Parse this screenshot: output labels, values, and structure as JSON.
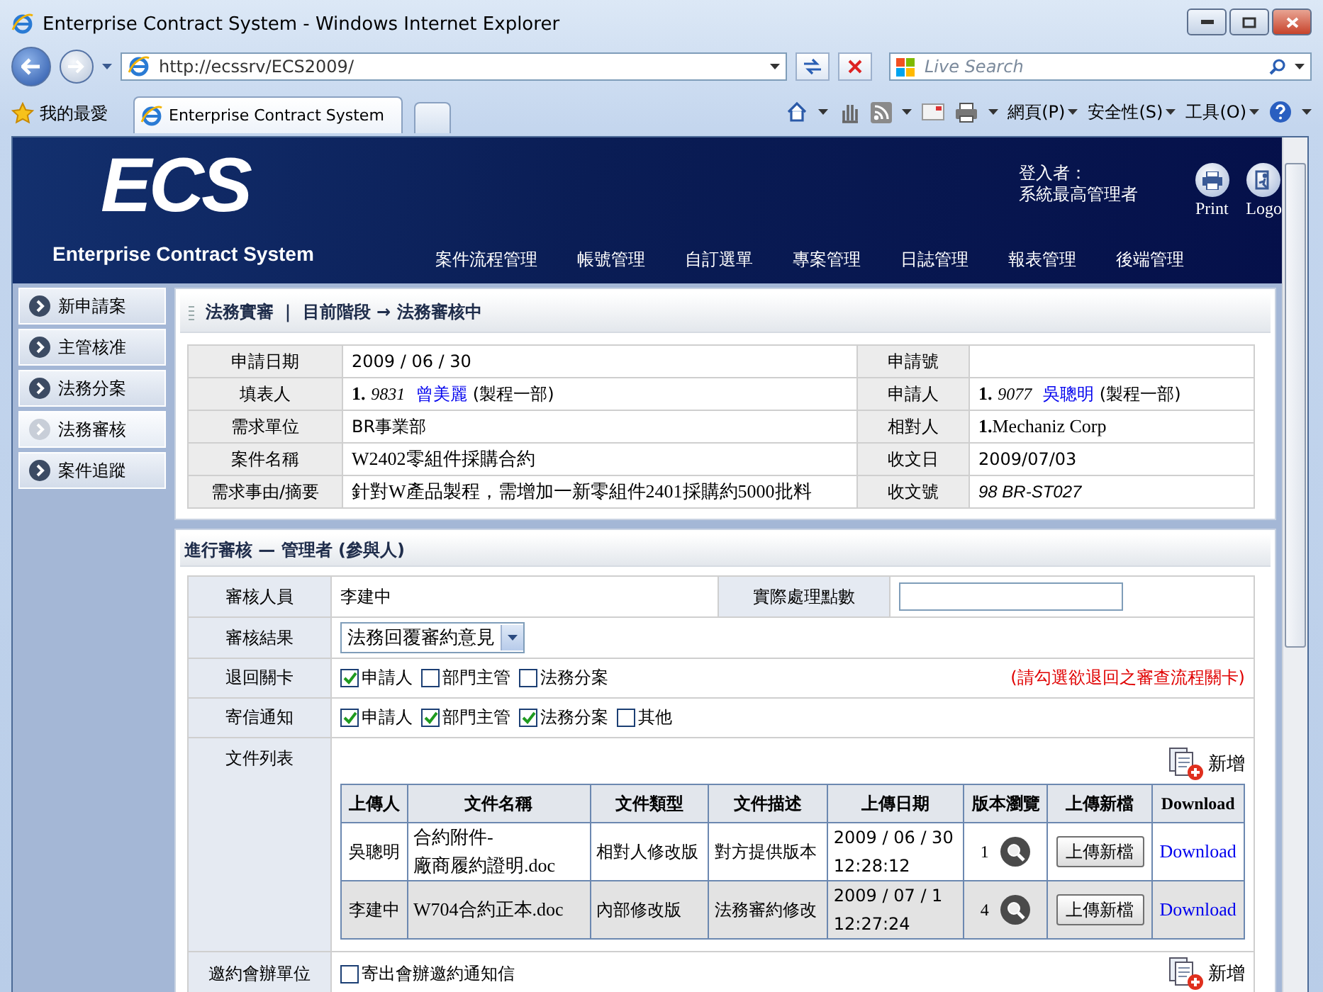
{
  "window": {
    "title": "Enterprise Contract System - Windows Internet Explorer",
    "address": "http://ecssrv/ECS2009/",
    "search_placeholder": "Live Search"
  },
  "command_bar": {
    "favorites": "我的最愛",
    "tabs": [
      {
        "label": "Enterprise Contract System",
        "selected": true
      }
    ],
    "menus": [
      "網頁(P)",
      "安全性(S)",
      "工具(O)"
    ]
  },
  "header": {
    "logo": "ECS",
    "subtitle": "Enterprise Contract System",
    "login_label": "登入者：",
    "login_user": "系統最高管理者",
    "actions": [
      {
        "kind": "print",
        "label": "Print"
      },
      {
        "kind": "logout",
        "label": "Logo"
      }
    ],
    "menu": [
      "案件流程管理",
      "帳號管理",
      "自訂選單",
      "專案管理",
      "日誌管理",
      "報表管理",
      "後端管理"
    ]
  },
  "sidebar": [
    {
      "label": "新申請案",
      "selected": false
    },
    {
      "label": "主管核准",
      "selected": false
    },
    {
      "label": "法務分案",
      "selected": false
    },
    {
      "label": "法務審核",
      "selected": true
    },
    {
      "label": "案件追蹤",
      "selected": false
    }
  ],
  "case_panel": {
    "title": "法務實審 ｜ 目前階段 → 法務審核中",
    "rows": [
      {
        "cells": [
          {
            "kind": "label",
            "text": "申請日期"
          },
          {
            "kind": "text",
            "text": "2009 / 06 / 30"
          },
          {
            "kind": "label",
            "text": "申請號"
          },
          {
            "kind": "empty"
          }
        ]
      },
      {
        "cells": [
          {
            "kind": "label",
            "text": "填表人"
          },
          {
            "kind": "person",
            "number": "1.",
            "code": "9831",
            "name": "曾美麗",
            "dept": "(製程一部)"
          },
          {
            "kind": "label",
            "text": "申請人"
          },
          {
            "kind": "person",
            "number": "1.",
            "code": "9077",
            "name": "吳聰明",
            "dept": "(製程一部)"
          }
        ]
      },
      {
        "cells": [
          {
            "kind": "label",
            "text": "需求單位"
          },
          {
            "kind": "text",
            "text": "BR事業部"
          },
          {
            "kind": "label",
            "text": "相對人"
          },
          {
            "kind": "serif",
            "text": "**1.**Mechaniz Corp"
          }
        ]
      },
      {
        "cells": [
          {
            "kind": "label",
            "text": "案件名稱"
          },
          {
            "kind": "serif",
            "text": "W2402零組件採購合約"
          },
          {
            "kind": "label",
            "text": "收文日"
          },
          {
            "kind": "text",
            "text": "2009/07/03"
          }
        ]
      },
      {
        "cells": [
          {
            "kind": "label",
            "text": "需求事由/摘要"
          },
          {
            "kind": "serif",
            "text": "針對W產品製程，需增加一新零組件2401採購約5000批料"
          },
          {
            "kind": "label",
            "text": "收文號"
          },
          {
            "kind": "italic",
            "text": "98 BR-ST027"
          }
        ]
      }
    ]
  },
  "review_panel": {
    "title": "進行審核 — 管理者 (參與人)",
    "reviewer": {
      "label": "審核人員",
      "value": "李建中"
    },
    "points": {
      "label": "實際處理點數"
    },
    "result": {
      "label": "審核結果",
      "value": "法務回覆審約意見"
    },
    "return_steps": {
      "label": "退回關卡",
      "options": [
        {
          "label": "申請人",
          "checked": true
        },
        {
          "label": "部門主管",
          "checked": false
        },
        {
          "label": "法務分案",
          "checked": false
        }
      ],
      "note": "(請勾選欲退回之審查流程關卡)"
    },
    "notify": {
      "label": "寄信通知",
      "options": [
        {
          "label": "申請人",
          "checked": true
        },
        {
          "label": "部門主管",
          "checked": true
        },
        {
          "label": "法務分案",
          "checked": true
        },
        {
          "label": "其他",
          "checked": false
        }
      ]
    },
    "files": {
      "label": "文件列表",
      "add": "新增",
      "columns": [
        "上傳人",
        "文件名稱",
        "文件類型",
        "文件描述",
        "上傳日期",
        "版本瀏覽",
        "上傳新檔",
        "Download"
      ],
      "rows": [
        {
          "uploader": "吳聰明",
          "name": "合約附件-\n廠商履約證明.doc",
          "type": "相對人修改版",
          "description": "對方提供版本",
          "date": "2009 / 06 / 30",
          "time": "12:28:12",
          "version": "1",
          "upload": "上傳新檔",
          "download": "Download"
        },
        {
          "uploader": "李建中",
          "name": "W704合約正本.doc",
          "type": "內部修改版",
          "description": "法務審約修改",
          "date": "2009 / 07 / 1",
          "time": "12:27:24",
          "version": "4",
          "upload": "上傳新檔",
          "download": "Download"
        }
      ]
    },
    "invite": {
      "label": "邀約會辦單位",
      "option": {
        "label": "寄出會辦邀約通知信",
        "checked": false
      },
      "add": "新增"
    }
  }
}
